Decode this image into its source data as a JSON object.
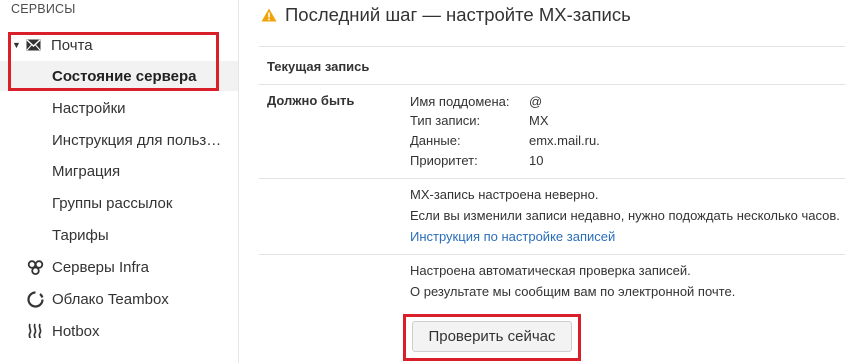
{
  "sidebar": {
    "section_title": "СЕРВИСЫ",
    "mail": {
      "label": "Почта",
      "icon": "envelope-icon",
      "expanded": true,
      "children": [
        {
          "label": "Состояние сервера",
          "active": true
        },
        {
          "label": "Настройки"
        },
        {
          "label": "Инструкция для польз…"
        },
        {
          "label": "Миграция"
        },
        {
          "label": "Группы рассылок"
        },
        {
          "label": "Тарифы"
        }
      ]
    },
    "services": [
      {
        "label": "Серверы Infra",
        "icon": "infra-icon"
      },
      {
        "label": "Облако Teambox",
        "icon": "cloud-ring-icon"
      },
      {
        "label": "Hotbox",
        "icon": "hotbox-icon"
      }
    ]
  },
  "main": {
    "title": "Последний шаг — настройте MX-запись",
    "current_record_label": "Текущая запись",
    "should_be_label": "Должно быть",
    "fields": [
      {
        "key": "Имя поддомена:",
        "value": "@"
      },
      {
        "key": "Тип записи:",
        "value": "MX"
      },
      {
        "key": "Данные:",
        "value": "emx.mail.ru."
      },
      {
        "key": "Приоритет:",
        "value": "10"
      }
    ],
    "error_line1": "MX-запись настроена неверно.",
    "error_line2": "Если вы изменили записи недавно, нужно подождать несколько часов.",
    "instructions_link": "Инструкция по настройке записей",
    "auto_line1": "Настроена автоматическая проверка записей.",
    "auto_line2": "О результате мы сообщим вам по электронной почте.",
    "check_button": "Проверить сейчас"
  },
  "colors": {
    "highlight": "#d9202a",
    "warning": "#f0a30a",
    "link": "#2a6ebb",
    "active_bg": "#f2f2f2"
  }
}
